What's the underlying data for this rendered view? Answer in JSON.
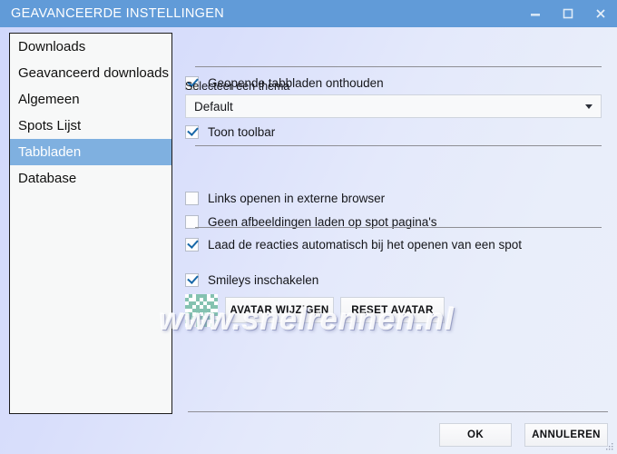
{
  "window": {
    "title": "GEAVANCEERDE INSTELLINGEN",
    "titlebar_color": "#619bd8",
    "accent_color": "#7fb0e0",
    "controls": [
      {
        "name": "minimize",
        "glyph": "minimize-icon"
      },
      {
        "name": "maximize",
        "glyph": "maximize-icon"
      },
      {
        "name": "close",
        "glyph": "close-icon"
      }
    ]
  },
  "sidebar": {
    "items": [
      {
        "label": "Downloads",
        "selected": false
      },
      {
        "label": "Geavanceerd downloads",
        "selected": false
      },
      {
        "label": "Algemeen",
        "selected": false
      },
      {
        "label": "Spots Lijst",
        "selected": false
      },
      {
        "label": "Tabbladen",
        "selected": true
      },
      {
        "label": "Database",
        "selected": false
      }
    ]
  },
  "main": {
    "checkboxes": [
      {
        "label": "Geopende tabbladen onthouden",
        "checked": true
      },
      {
        "label": "Toon toolbar",
        "checked": true
      },
      {
        "label": "Links openen in externe browser",
        "checked": false
      },
      {
        "label": "Geen afbeeldingen laden op spot pagina's",
        "checked": false
      },
      {
        "label": "Laad de reacties automatisch bij het openen van een spot",
        "checked": true
      },
      {
        "label": "Smileys inschakelen",
        "checked": true
      }
    ],
    "theme": {
      "label": "Selecteer een thema",
      "value": "Default",
      "options": [
        "Default"
      ]
    },
    "avatar": {
      "name": "avatar-identicon",
      "color": "#84c2b0"
    },
    "avatar_buttons": [
      {
        "label": "AVATAR WIJZIGEN"
      },
      {
        "label": "RESET AVATAR"
      }
    ]
  },
  "footer": {
    "ok_label": "OK",
    "cancel_label": "ANNULEREN"
  },
  "watermark": {
    "text": "www.snelrennen.nl"
  }
}
